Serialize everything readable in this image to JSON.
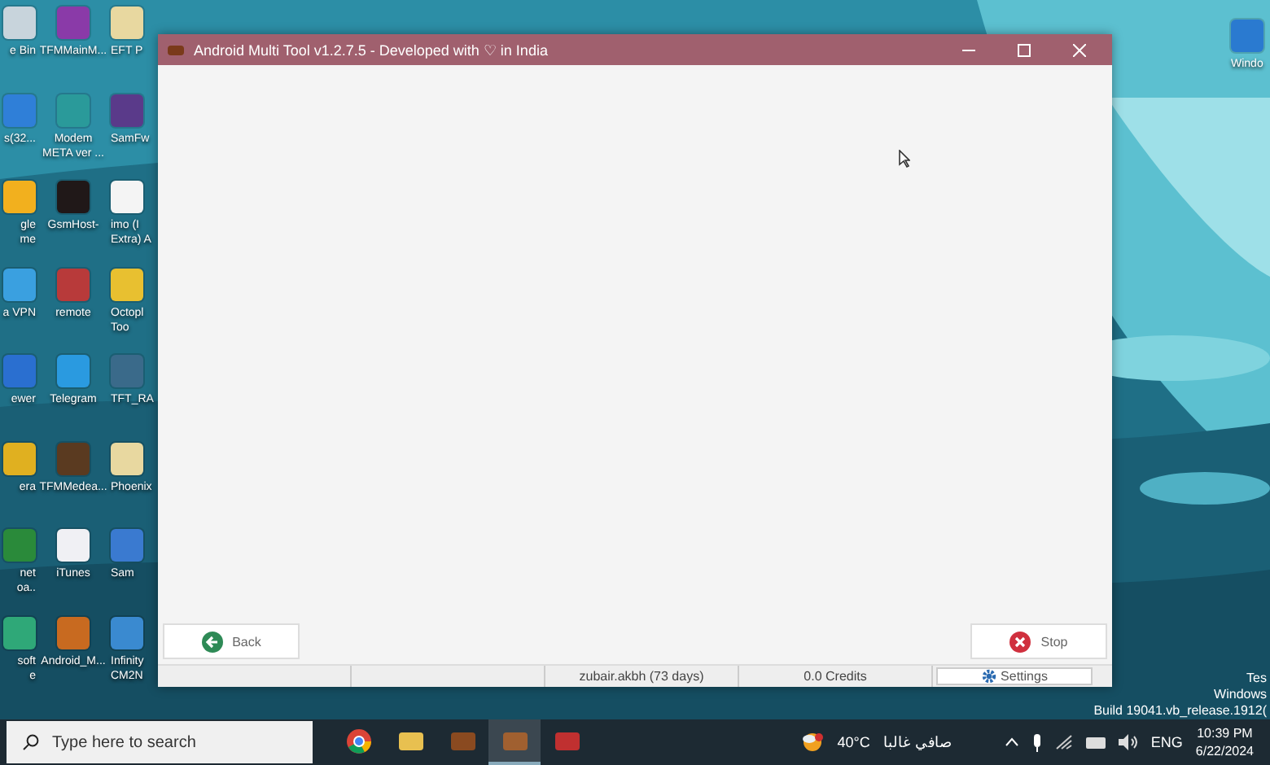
{
  "icon_rows": [
    {
      "icons": [
        {
          "label": "e Bin",
          "color": "#c8d4dc"
        },
        {
          "label": "TFMMainM...",
          "color": "#8a3aa8"
        },
        {
          "label": "EFT P",
          "color": "#e8d8a0"
        }
      ]
    },
    {
      "icons": [
        {
          "label": "s(32...",
          "color": "#2f7fd8"
        },
        {
          "label": "Modem\nMETA ver ...",
          "color": "#2a9a9a"
        },
        {
          "label": "SamFw",
          "color": "#5a3a8a"
        }
      ]
    },
    {
      "icons": [
        {
          "label": "gle\nme",
          "color": "#f2b01e"
        },
        {
          "label": "GsmHost-",
          "color": "#201818"
        },
        {
          "label": "imo (I\nExtra) A",
          "color": "#f4f4f4"
        }
      ]
    },
    {
      "icons": [
        {
          "label": "a VPN",
          "color": "#3aa0e0"
        },
        {
          "label": "remote",
          "color": "#b83a3a"
        },
        {
          "label": "Octopl\nToo",
          "color": "#e8c030"
        }
      ]
    },
    {
      "icons": [
        {
          "label": "ewer",
          "color": "#2a6fd0"
        },
        {
          "label": "Telegram",
          "color": "#2a9ae0"
        },
        {
          "label": "TFT_RA",
          "color": "#3a6a8a"
        }
      ]
    },
    {
      "icons": [
        {
          "label": "era",
          "color": "#e0b020"
        },
        {
          "label": "TFMMedea...",
          "color": "#5a3a20"
        },
        {
          "label": "Phoenix",
          "color": "#e8d8a0"
        }
      ]
    },
    {
      "icons": [
        {
          "label": "net\noa..",
          "color": "#2a8a3a"
        },
        {
          "label": "iTunes",
          "color": "#f0f0f4"
        },
        {
          "label": "Sam",
          "color": "#3a7ad0"
        }
      ]
    },
    {
      "icons": [
        {
          "label": "soft\ne",
          "color": "#2fa878"
        },
        {
          "label": "Android_M...",
          "color": "#c86a20"
        },
        {
          "label": "Infinity\nCM2N",
          "color": "#3a8ad0"
        }
      ]
    }
  ],
  "corner_icon": {
    "label": "Windo"
  },
  "window": {
    "title": "Android Multi Tool v1.2.7.5 - Developed with ♡ in India",
    "buttons": [
      {
        "label": "Back",
        "kind": "back"
      },
      {
        "label": "Stop",
        "kind": "stop"
      }
    ],
    "status_bar": [
      {
        "kind": "blank"
      },
      {
        "kind": "blank"
      },
      {
        "kind": "text",
        "text": "zubair.akbh (73 days)"
      },
      {
        "kind": "text",
        "text": "0.0 Credits"
      },
      {
        "kind": "button",
        "text": "Settings"
      }
    ]
  },
  "watermark_lines": [
    "Tes",
    "Windows",
    "Build 19041.vb_release.1912("
  ],
  "taskbar": {
    "search_placeholder": "Type here to search",
    "apps": [
      {
        "kind": "chrome",
        "active": false
      },
      {
        "kind": "folder",
        "active": false
      },
      {
        "kind": "app",
        "active": false
      },
      {
        "kind": "app2",
        "active": true
      },
      {
        "kind": "app3",
        "active": false
      }
    ],
    "weather": "40°C",
    "weather_text": "صافي غالبا",
    "language": "ENG",
    "time": "10:39 PM",
    "date": "6/22/2024"
  }
}
